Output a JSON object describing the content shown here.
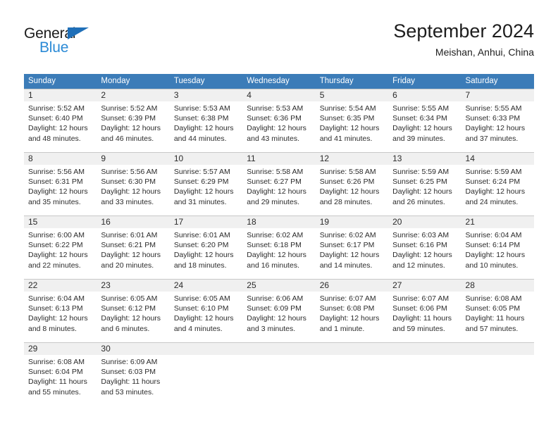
{
  "brand": {
    "name_top": "General",
    "name_bottom": "Blue",
    "triangle_color": "#1f6fb8",
    "blue_text_color": "#2b8ad6"
  },
  "header": {
    "title": "September 2024",
    "subtitle": "Meishan, Anhui, China"
  },
  "theme": {
    "header_blue": "#3c7cb8",
    "day_band_gray": "#f0f0f0",
    "grid_line": "#c8c8c8",
    "text": "#2b2b2b"
  },
  "weekdays": [
    "Sunday",
    "Monday",
    "Tuesday",
    "Wednesday",
    "Thursday",
    "Friday",
    "Saturday"
  ],
  "weeks": [
    [
      {
        "day": "1",
        "sunrise": "Sunrise: 5:52 AM",
        "sunset": "Sunset: 6:40 PM",
        "daylight1": "Daylight: 12 hours",
        "daylight2": "and 48 minutes."
      },
      {
        "day": "2",
        "sunrise": "Sunrise: 5:52 AM",
        "sunset": "Sunset: 6:39 PM",
        "daylight1": "Daylight: 12 hours",
        "daylight2": "and 46 minutes."
      },
      {
        "day": "3",
        "sunrise": "Sunrise: 5:53 AM",
        "sunset": "Sunset: 6:38 PM",
        "daylight1": "Daylight: 12 hours",
        "daylight2": "and 44 minutes."
      },
      {
        "day": "4",
        "sunrise": "Sunrise: 5:53 AM",
        "sunset": "Sunset: 6:36 PM",
        "daylight1": "Daylight: 12 hours",
        "daylight2": "and 43 minutes."
      },
      {
        "day": "5",
        "sunrise": "Sunrise: 5:54 AM",
        "sunset": "Sunset: 6:35 PM",
        "daylight1": "Daylight: 12 hours",
        "daylight2": "and 41 minutes."
      },
      {
        "day": "6",
        "sunrise": "Sunrise: 5:55 AM",
        "sunset": "Sunset: 6:34 PM",
        "daylight1": "Daylight: 12 hours",
        "daylight2": "and 39 minutes."
      },
      {
        "day": "7",
        "sunrise": "Sunrise: 5:55 AM",
        "sunset": "Sunset: 6:33 PM",
        "daylight1": "Daylight: 12 hours",
        "daylight2": "and 37 minutes."
      }
    ],
    [
      {
        "day": "8",
        "sunrise": "Sunrise: 5:56 AM",
        "sunset": "Sunset: 6:31 PM",
        "daylight1": "Daylight: 12 hours",
        "daylight2": "and 35 minutes."
      },
      {
        "day": "9",
        "sunrise": "Sunrise: 5:56 AM",
        "sunset": "Sunset: 6:30 PM",
        "daylight1": "Daylight: 12 hours",
        "daylight2": "and 33 minutes."
      },
      {
        "day": "10",
        "sunrise": "Sunrise: 5:57 AM",
        "sunset": "Sunset: 6:29 PM",
        "daylight1": "Daylight: 12 hours",
        "daylight2": "and 31 minutes."
      },
      {
        "day": "11",
        "sunrise": "Sunrise: 5:58 AM",
        "sunset": "Sunset: 6:27 PM",
        "daylight1": "Daylight: 12 hours",
        "daylight2": "and 29 minutes."
      },
      {
        "day": "12",
        "sunrise": "Sunrise: 5:58 AM",
        "sunset": "Sunset: 6:26 PM",
        "daylight1": "Daylight: 12 hours",
        "daylight2": "and 28 minutes."
      },
      {
        "day": "13",
        "sunrise": "Sunrise: 5:59 AM",
        "sunset": "Sunset: 6:25 PM",
        "daylight1": "Daylight: 12 hours",
        "daylight2": "and 26 minutes."
      },
      {
        "day": "14",
        "sunrise": "Sunrise: 5:59 AM",
        "sunset": "Sunset: 6:24 PM",
        "daylight1": "Daylight: 12 hours",
        "daylight2": "and 24 minutes."
      }
    ],
    [
      {
        "day": "15",
        "sunrise": "Sunrise: 6:00 AM",
        "sunset": "Sunset: 6:22 PM",
        "daylight1": "Daylight: 12 hours",
        "daylight2": "and 22 minutes."
      },
      {
        "day": "16",
        "sunrise": "Sunrise: 6:01 AM",
        "sunset": "Sunset: 6:21 PM",
        "daylight1": "Daylight: 12 hours",
        "daylight2": "and 20 minutes."
      },
      {
        "day": "17",
        "sunrise": "Sunrise: 6:01 AM",
        "sunset": "Sunset: 6:20 PM",
        "daylight1": "Daylight: 12 hours",
        "daylight2": "and 18 minutes."
      },
      {
        "day": "18",
        "sunrise": "Sunrise: 6:02 AM",
        "sunset": "Sunset: 6:18 PM",
        "daylight1": "Daylight: 12 hours",
        "daylight2": "and 16 minutes."
      },
      {
        "day": "19",
        "sunrise": "Sunrise: 6:02 AM",
        "sunset": "Sunset: 6:17 PM",
        "daylight1": "Daylight: 12 hours",
        "daylight2": "and 14 minutes."
      },
      {
        "day": "20",
        "sunrise": "Sunrise: 6:03 AM",
        "sunset": "Sunset: 6:16 PM",
        "daylight1": "Daylight: 12 hours",
        "daylight2": "and 12 minutes."
      },
      {
        "day": "21",
        "sunrise": "Sunrise: 6:04 AM",
        "sunset": "Sunset: 6:14 PM",
        "daylight1": "Daylight: 12 hours",
        "daylight2": "and 10 minutes."
      }
    ],
    [
      {
        "day": "22",
        "sunrise": "Sunrise: 6:04 AM",
        "sunset": "Sunset: 6:13 PM",
        "daylight1": "Daylight: 12 hours",
        "daylight2": "and 8 minutes."
      },
      {
        "day": "23",
        "sunrise": "Sunrise: 6:05 AM",
        "sunset": "Sunset: 6:12 PM",
        "daylight1": "Daylight: 12 hours",
        "daylight2": "and 6 minutes."
      },
      {
        "day": "24",
        "sunrise": "Sunrise: 6:05 AM",
        "sunset": "Sunset: 6:10 PM",
        "daylight1": "Daylight: 12 hours",
        "daylight2": "and 4 minutes."
      },
      {
        "day": "25",
        "sunrise": "Sunrise: 6:06 AM",
        "sunset": "Sunset: 6:09 PM",
        "daylight1": "Daylight: 12 hours",
        "daylight2": "and 3 minutes."
      },
      {
        "day": "26",
        "sunrise": "Sunrise: 6:07 AM",
        "sunset": "Sunset: 6:08 PM",
        "daylight1": "Daylight: 12 hours",
        "daylight2": "and 1 minute."
      },
      {
        "day": "27",
        "sunrise": "Sunrise: 6:07 AM",
        "sunset": "Sunset: 6:06 PM",
        "daylight1": "Daylight: 11 hours",
        "daylight2": "and 59 minutes."
      },
      {
        "day": "28",
        "sunrise": "Sunrise: 6:08 AM",
        "sunset": "Sunset: 6:05 PM",
        "daylight1": "Daylight: 11 hours",
        "daylight2": "and 57 minutes."
      }
    ],
    [
      {
        "day": "29",
        "sunrise": "Sunrise: 6:08 AM",
        "sunset": "Sunset: 6:04 PM",
        "daylight1": "Daylight: 11 hours",
        "daylight2": "and 55 minutes."
      },
      {
        "day": "30",
        "sunrise": "Sunrise: 6:09 AM",
        "sunset": "Sunset: 6:03 PM",
        "daylight1": "Daylight: 11 hours",
        "daylight2": "and 53 minutes."
      },
      {
        "day": "",
        "sunrise": "",
        "sunset": "",
        "daylight1": "",
        "daylight2": ""
      },
      {
        "day": "",
        "sunrise": "",
        "sunset": "",
        "daylight1": "",
        "daylight2": ""
      },
      {
        "day": "",
        "sunrise": "",
        "sunset": "",
        "daylight1": "",
        "daylight2": ""
      },
      {
        "day": "",
        "sunrise": "",
        "sunset": "",
        "daylight1": "",
        "daylight2": ""
      },
      {
        "day": "",
        "sunrise": "",
        "sunset": "",
        "daylight1": "",
        "daylight2": ""
      }
    ]
  ]
}
